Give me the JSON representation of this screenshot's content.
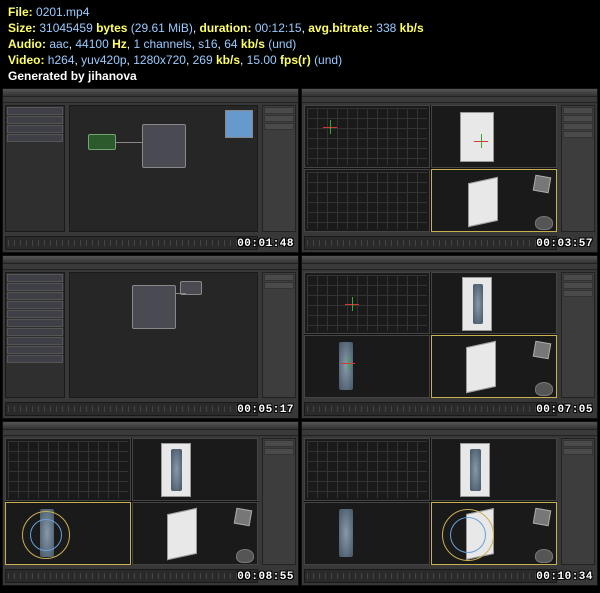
{
  "header": {
    "file_label": "File:",
    "file_value": "0201.mp4",
    "size_label": "Size:",
    "size_bytes": "31045459",
    "size_bytes_unit": "bytes",
    "size_mib": "(29.61 MiB)",
    "duration_label": "duration:",
    "duration_value": "00:12:15",
    "bitrate_label": "avg.bitrate:",
    "bitrate_value": "338",
    "bitrate_unit": "kb/s",
    "audio_label": "Audio:",
    "audio_codec": "aac",
    "audio_hz": "44100",
    "audio_hz_unit": "Hz",
    "audio_channels": "1 channels",
    "audio_s16": "s16",
    "audio_kb": "64",
    "audio_kb_unit": "kb/s",
    "audio_und": "(und)",
    "video_label": "Video:",
    "video_codec": "h264",
    "video_pix": "yuv420p",
    "video_res": "1280x720",
    "video_kb": "269",
    "video_kb_unit": "kb/s",
    "video_fps": "15.00",
    "video_fps_unit": "fps(r)",
    "video_und": "(und)",
    "gen_label": "Generated by",
    "gen_user": "jihanova"
  },
  "thumbs": [
    {
      "layout": "node-editor",
      "timestamp": "00:01:48"
    },
    {
      "layout": "quad-ref",
      "timestamp": "00:03:57"
    },
    {
      "layout": "node-editor-list",
      "timestamp": "00:05:17"
    },
    {
      "layout": "quad-figure",
      "timestamp": "00:07:05"
    },
    {
      "layout": "quad-gizmo-left",
      "timestamp": "00:08:55"
    },
    {
      "layout": "quad-gizmo-right",
      "timestamp": "00:10:34"
    }
  ]
}
